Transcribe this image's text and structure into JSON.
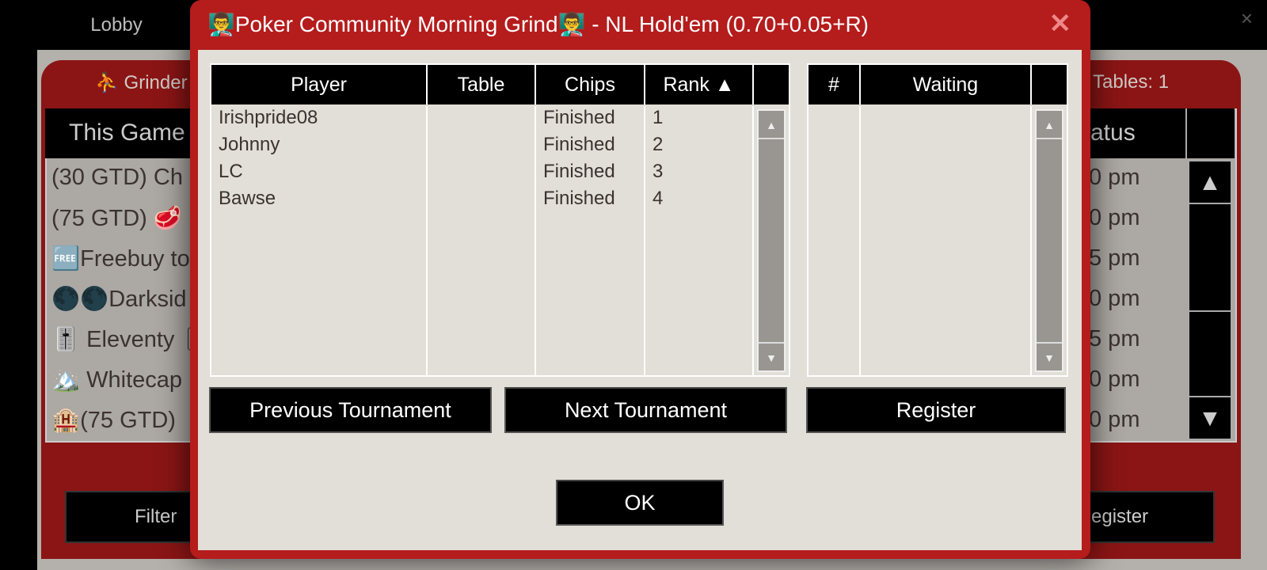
{
  "lobby": {
    "tab": "Lobby",
    "close": "×",
    "title": "⛹ Grinder",
    "tables": "Tables: 1",
    "header": "This Game",
    "status_header": "atus",
    "rows": [
      "(30 GTD) Ch",
      "(75 GTD) 🥩",
      "🆓Freebuy to",
      "🌑🌑Darksid",
      "🎚️ Eleventy 🎚",
      "🏔️ Whitecap",
      "🏨(75 GTD)"
    ],
    "times": [
      "0 pm",
      "0 pm",
      "5 pm",
      "0 pm",
      "5 pm",
      "0 pm",
      "0 pm"
    ],
    "filter": "Filter",
    "register": "egister"
  },
  "dialog": {
    "title": "👨‍🏫Poker Community Morning Grind👨‍🏫 - NL Hold'em (0.70+0.05+R)",
    "close": "✕",
    "players": {
      "headers": [
        "Player",
        "Table",
        "Chips",
        "Rank ▲"
      ],
      "rows": [
        {
          "player": "Irishpride08",
          "table": "",
          "chips": "Finished",
          "rank": "1"
        },
        {
          "player": "Johnny",
          "table": "",
          "chips": "Finished",
          "rank": "2"
        },
        {
          "player": "LC",
          "table": "",
          "chips": "Finished",
          "rank": "3"
        },
        {
          "player": "Bawse",
          "table": "",
          "chips": "Finished",
          "rank": "4"
        }
      ]
    },
    "waiting": {
      "headers": [
        "#",
        "Waiting"
      ]
    },
    "buttons": {
      "previous": "Previous Tournament",
      "next": "Next Tournament",
      "register": "Register",
      "ok": "OK"
    }
  }
}
